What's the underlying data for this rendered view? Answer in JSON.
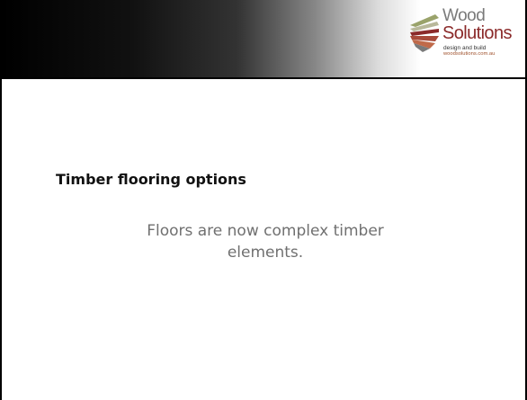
{
  "brand": {
    "name_line1": "Wood",
    "name_line2": "Solutions",
    "tagline": "design and build",
    "url": "woodsolutions.com.au",
    "colors": {
      "wood_text": "#7a7a7a",
      "solutions_text": "#8b2a2a",
      "url_text": "#a0522d"
    }
  },
  "slide": {
    "title": "Timber flooring options",
    "body": "Floors are now complex timber elements."
  },
  "theme": {
    "header_gradient_start": "#000000",
    "header_gradient_end": "#ffffff"
  }
}
